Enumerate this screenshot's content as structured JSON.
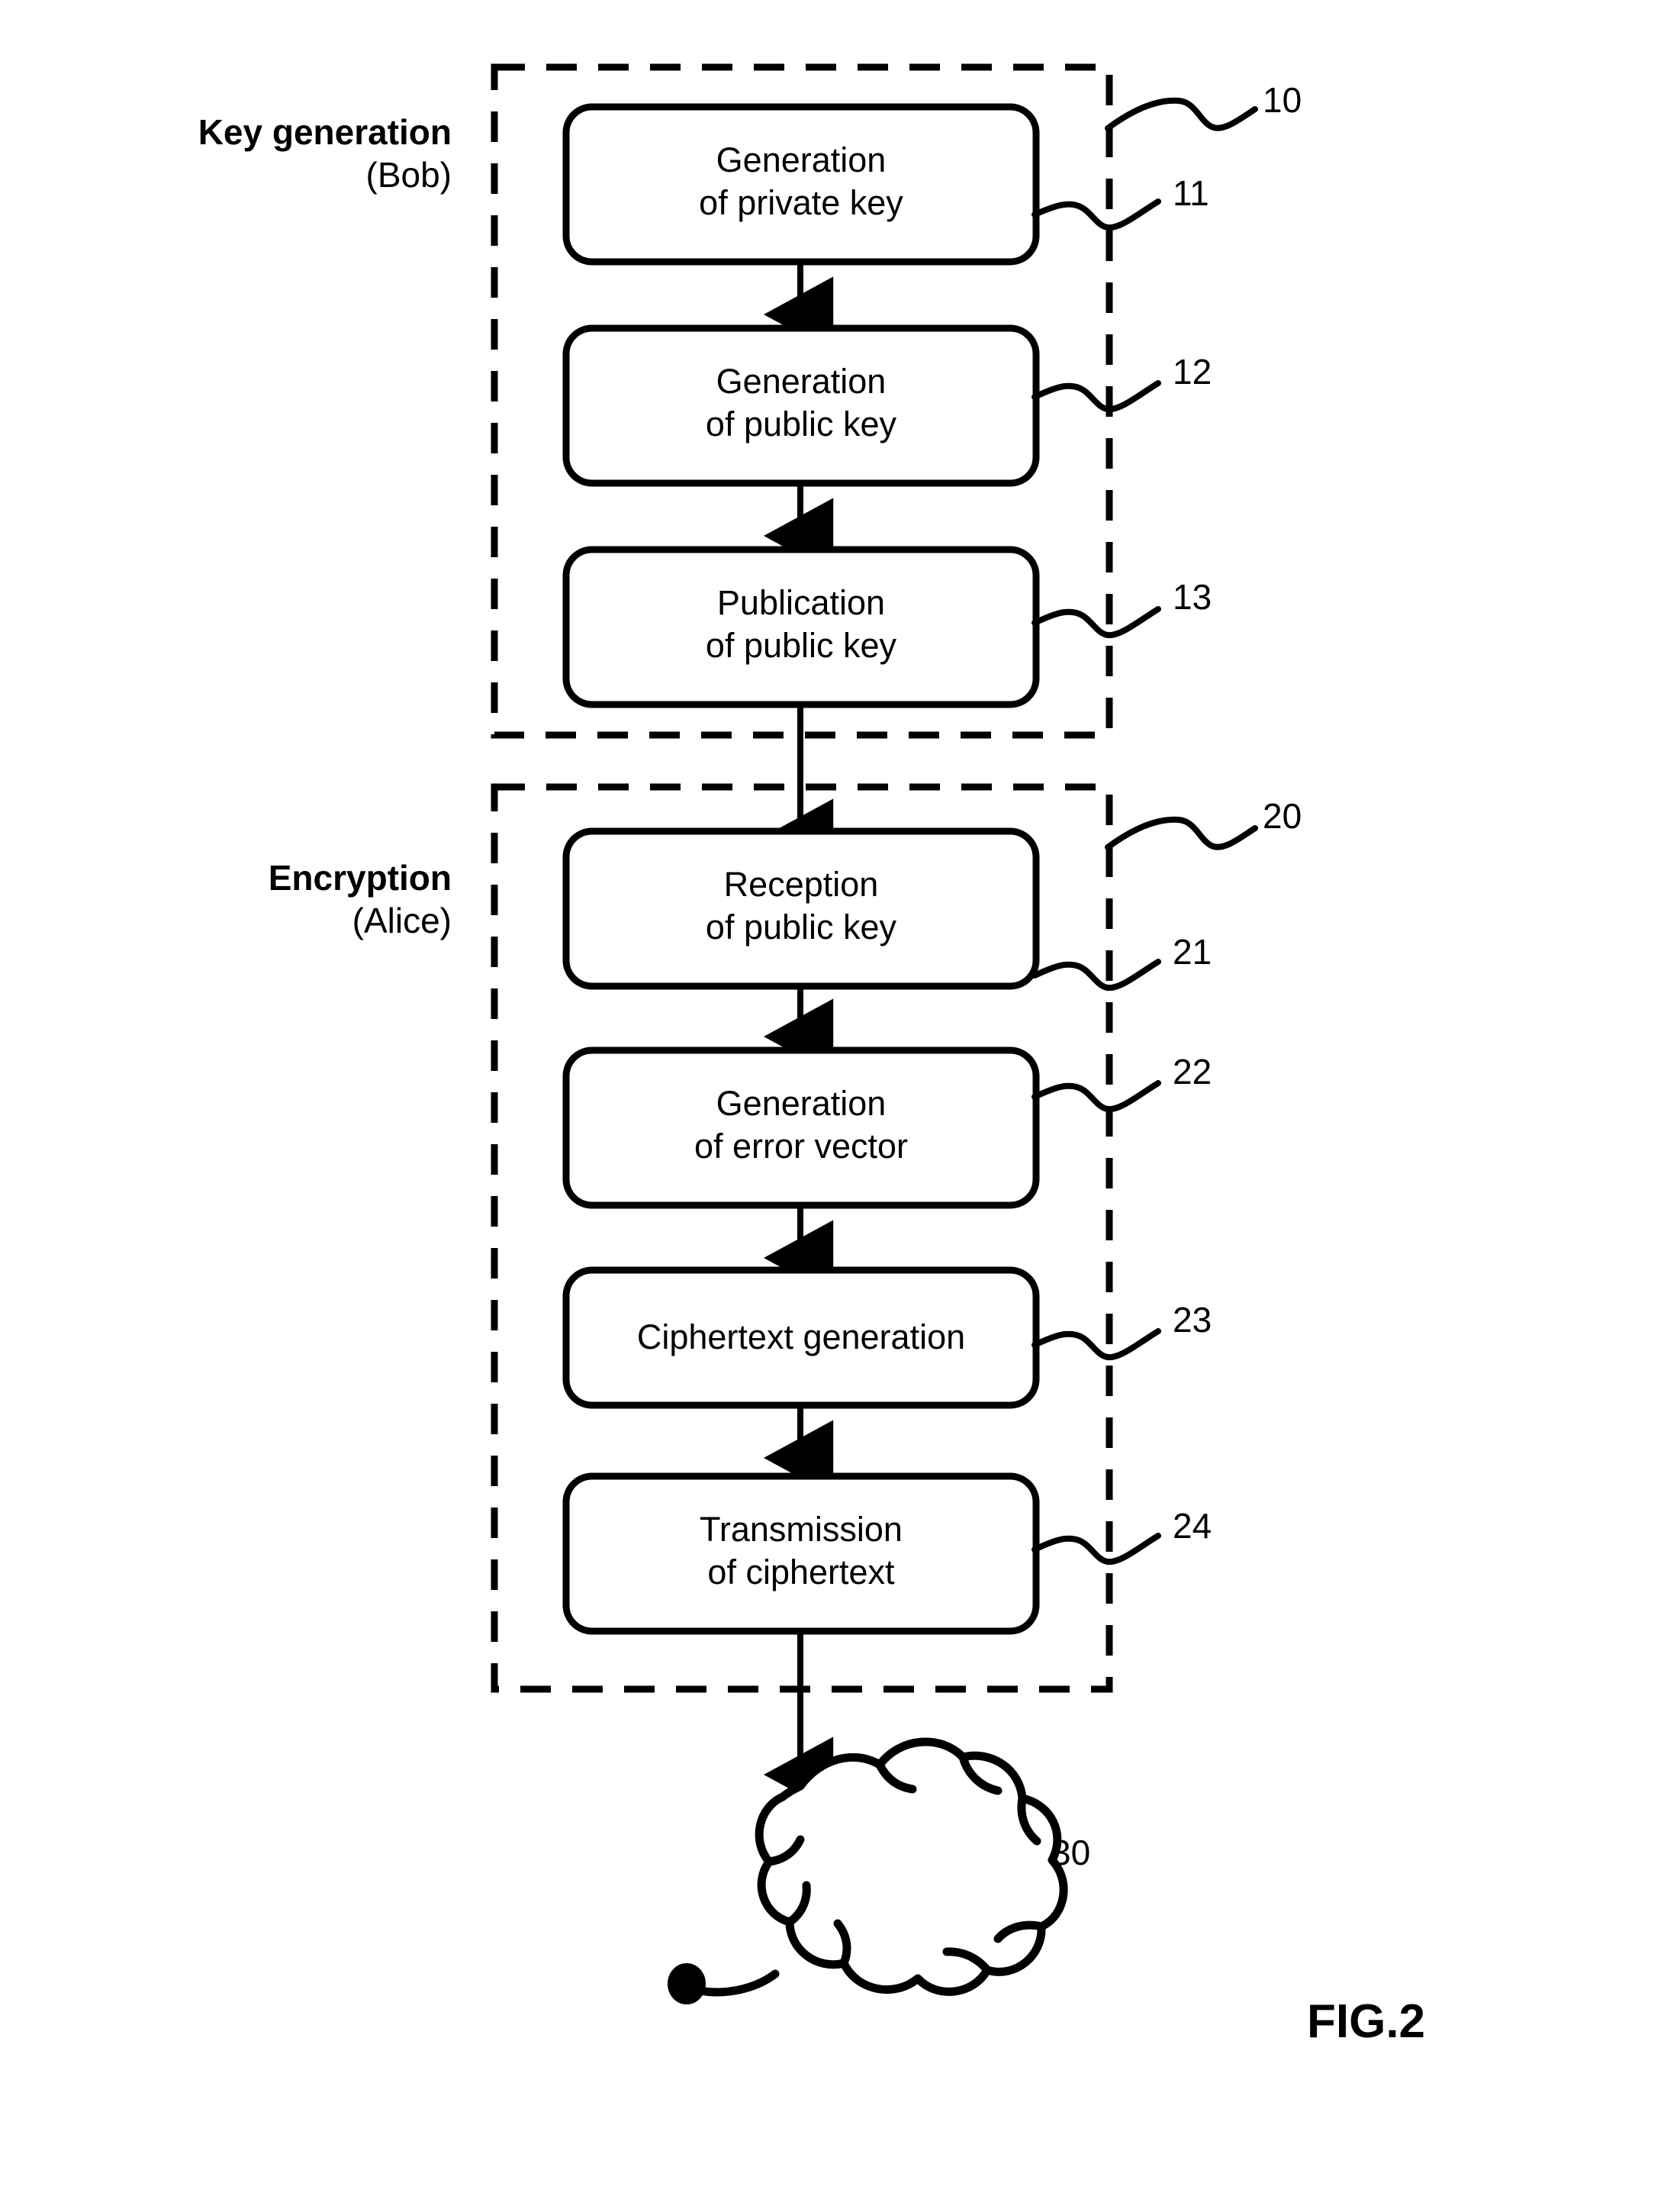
{
  "figure": {
    "caption": "FIG.2",
    "groups": [
      {
        "id": "key-generation",
        "title": "Key generation",
        "actor": "(Bob)",
        "ref": "10"
      },
      {
        "id": "encryption",
        "title": "Encryption",
        "actor": "(Alice)",
        "ref": "20"
      }
    ],
    "steps": [
      {
        "id": "generation-private-key",
        "ref": "11",
        "lines": [
          "Generation",
          "of private key"
        ]
      },
      {
        "id": "generation-public-key",
        "ref": "12",
        "lines": [
          "Generation",
          "of public key"
        ]
      },
      {
        "id": "publication-public-key",
        "ref": "13",
        "lines": [
          "Publication",
          "of public key"
        ]
      },
      {
        "id": "reception-public-key",
        "ref": "21",
        "lines": [
          "Reception",
          "of public key"
        ]
      },
      {
        "id": "generation-error-vector",
        "ref": "22",
        "lines": [
          "Generation",
          "of error vector"
        ]
      },
      {
        "id": "ciphertext-generation",
        "ref": "23",
        "lines": [
          "Ciphertext generation"
        ]
      },
      {
        "id": "transmission-ciphertext",
        "ref": "24",
        "lines": [
          "Transmission",
          "of ciphertext"
        ]
      }
    ],
    "cloud": {
      "id": "network-cloud",
      "ref": "30"
    },
    "colors": {
      "stroke": "#000000",
      "background": "#ffffff"
    }
  }
}
